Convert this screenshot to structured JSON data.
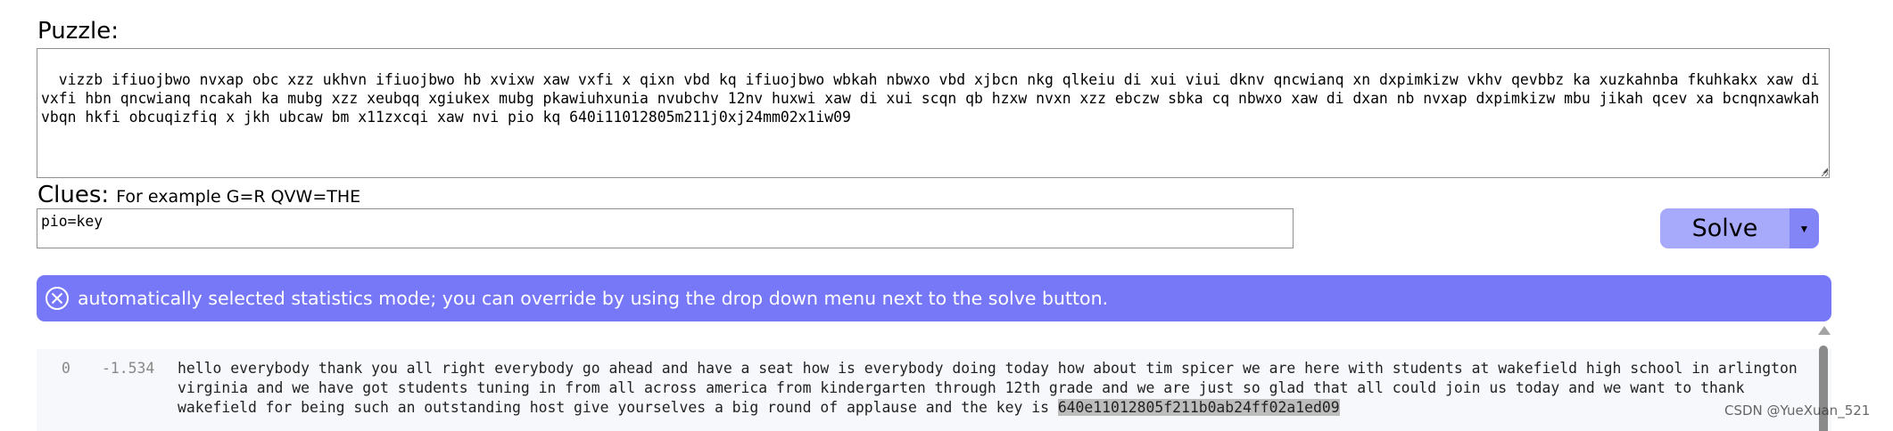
{
  "puzzle": {
    "label": "Puzzle:",
    "text": "vizzb ifiuojbwo nvxap obc xzz ukhvn ifiuojbwo hb xvixw xaw vxfi x qixn vbd kq ifiuojbwo wbkah nbwxo vbd xjbcn nkg qlkeiu di xui viui dknv qncwianq xn dxpimkizw vkhv qevbbz ka xuzkahnba fkuhkakx xaw di vxfi hbn qncwianq ncakah ka mubg xzz xeubqq xgiukex mubg pkawiuhxunia nvubchv 12nv huxwi xaw di xui scqn qb hzxw nvxn xzz ebczw sbka cq nbwxo xaw di dxan nb nvxap dxpimkizw mbu jikah qcev xa bcnqnxawkah vbqn hkfi obcuqizfiq x jkh ubcaw bm x11zxcqi xaw nvi pio kq 640i11012805m211j0xj24mm02x1iw09"
  },
  "clues": {
    "label": "Clues:",
    "hint": "For example G=R QVW=THE",
    "value": "pio=key"
  },
  "solve": {
    "label": "Solve",
    "dropdown_glyph": "▼"
  },
  "alert": {
    "message": "automatically selected statistics mode; you can override by using the drop down menu next to the solve button.",
    "icon": "close-circle-icon"
  },
  "results": [
    {
      "index": "0",
      "score": "-1.534",
      "text": "hello everybody thank you all right everybody go ahead and have a seat how is everybody doing today how about tim spicer we are here with students at wakefield high school in arlington virginia and we have got students tuning in from all across america from kindergarten through 12th grade and we are just so glad that all could join us today and we want to thank wakefield for being such an outstanding host give yourselves a big round of applause and the key is ",
      "key": "640e11012805f211b0ab24ff02a1ed09"
    }
  ],
  "watermark": "CSDN @YueXuan_521",
  "colors": {
    "solve_main": "#a7a9fb",
    "solve_dropdown": "#8385f6",
    "alert_bg": "#7778f8",
    "key_highlight": "#bdbdbd"
  }
}
